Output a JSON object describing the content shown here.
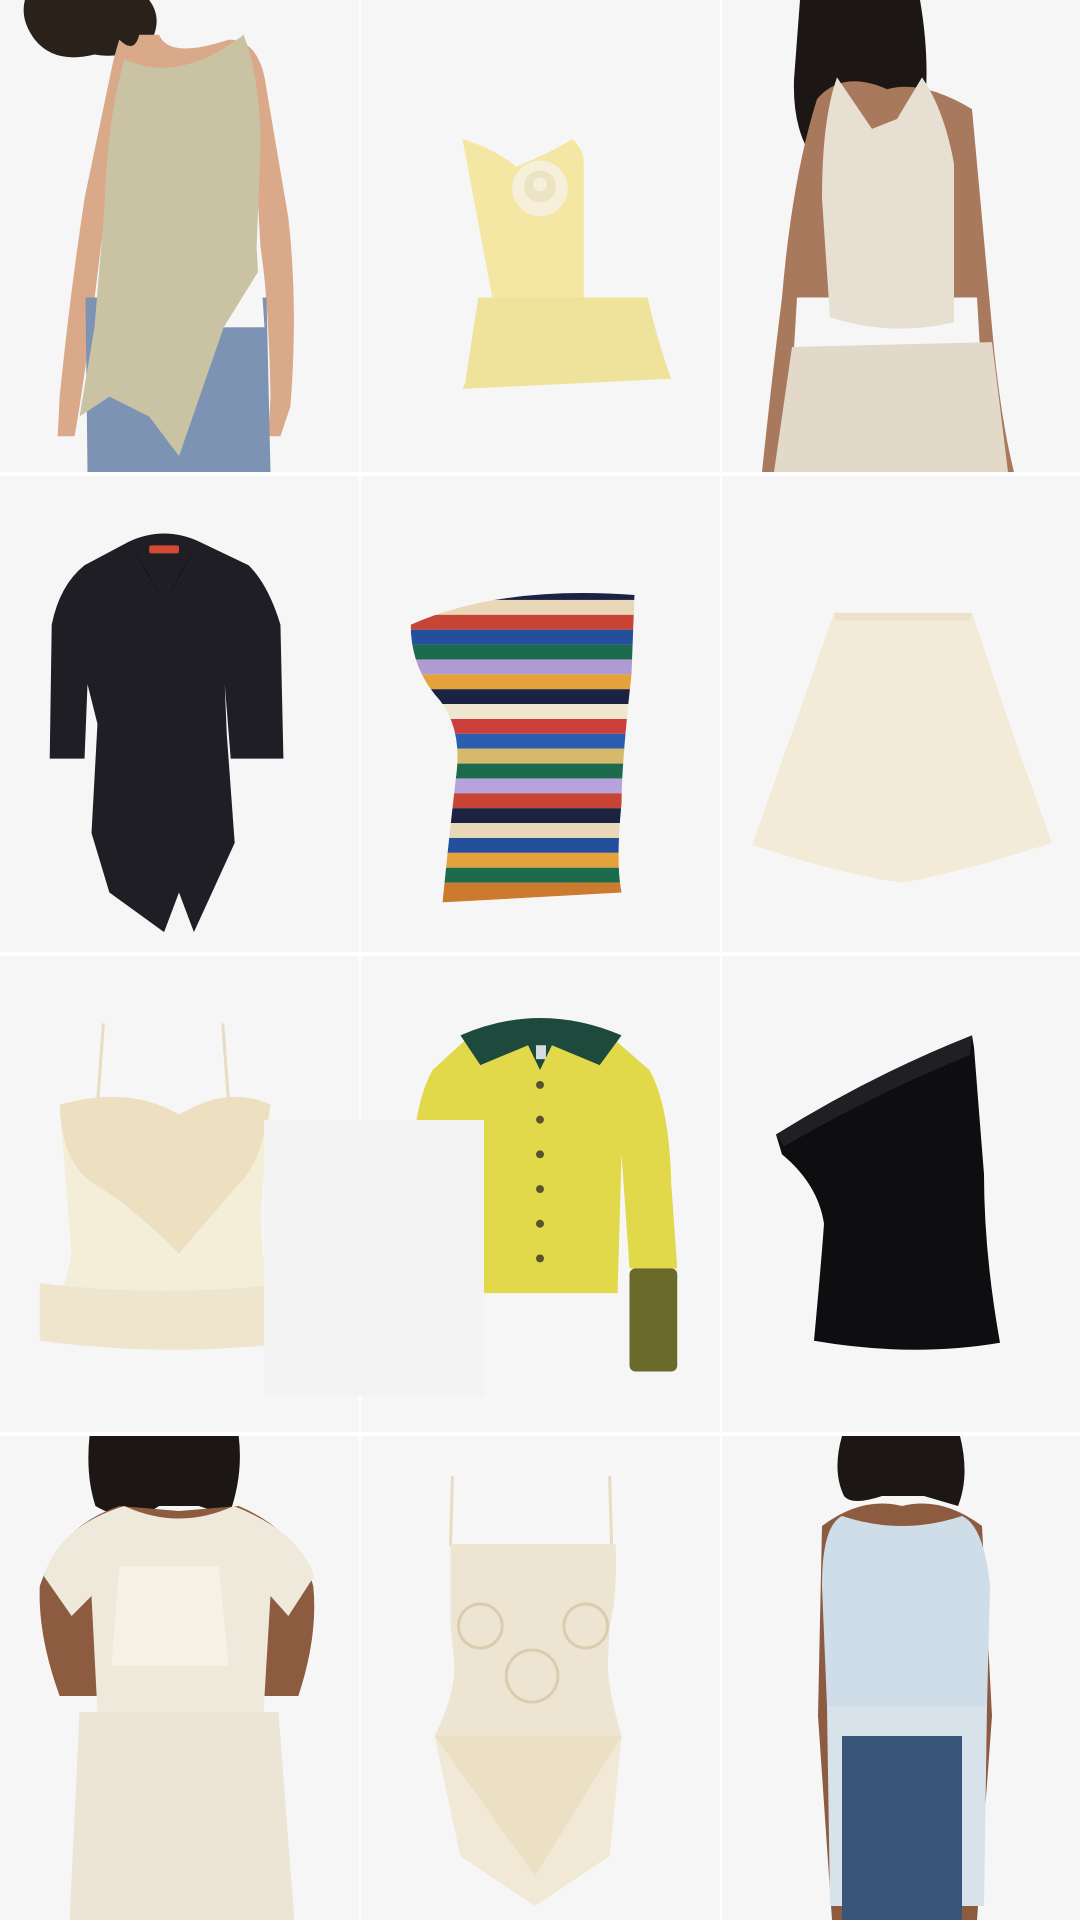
{
  "page": {
    "background": "#ffffff",
    "tile_background": "#f6f6f7"
  },
  "products": [
    {
      "id": "p1",
      "icon": "sage-asymmetric-tank-top-on-model",
      "color": "#c9c3a4"
    },
    {
      "id": "p2",
      "icon": "yellow-strapless-peplum-corset-top-with-rosette",
      "color": "#f3e7a3"
    },
    {
      "id": "p3",
      "icon": "champagne-satin-halter-top-on-model",
      "color": "#e6dfd2"
    },
    {
      "id": "p4",
      "icon": "black-button-down-shirt-with-rolled-sleeves",
      "color": "#1f1e24"
    },
    {
      "id": "p5",
      "icon": "multicolor-striped-one-shoulder-draped-top",
      "color": "#e7a24a"
    },
    {
      "id": "p6",
      "icon": "cream-flared-mini-skirt",
      "color": "#f3ead7"
    },
    {
      "id": "p7",
      "icon": "ivory-lace-ruffle-camisole",
      "color": "#f2ead3"
    },
    {
      "id": "p8",
      "icon": "yellow-shirt-with-beaded-collar-and-cuffs",
      "color": "#e1d84a"
    },
    {
      "id": "p9",
      "icon": "black-one-shoulder-draped-top",
      "color": "#0e0e10"
    },
    {
      "id": "p10",
      "icon": "sheer-lace-tee-and-skirt-on-model",
      "color": "#efe9dc"
    },
    {
      "id": "p11",
      "icon": "cream-crochet-fringe-camisole",
      "color": "#eee4d2"
    },
    {
      "id": "p12",
      "icon": "light-blue-open-knit-fringe-tunic-on-model",
      "color": "#cfdde8"
    }
  ]
}
